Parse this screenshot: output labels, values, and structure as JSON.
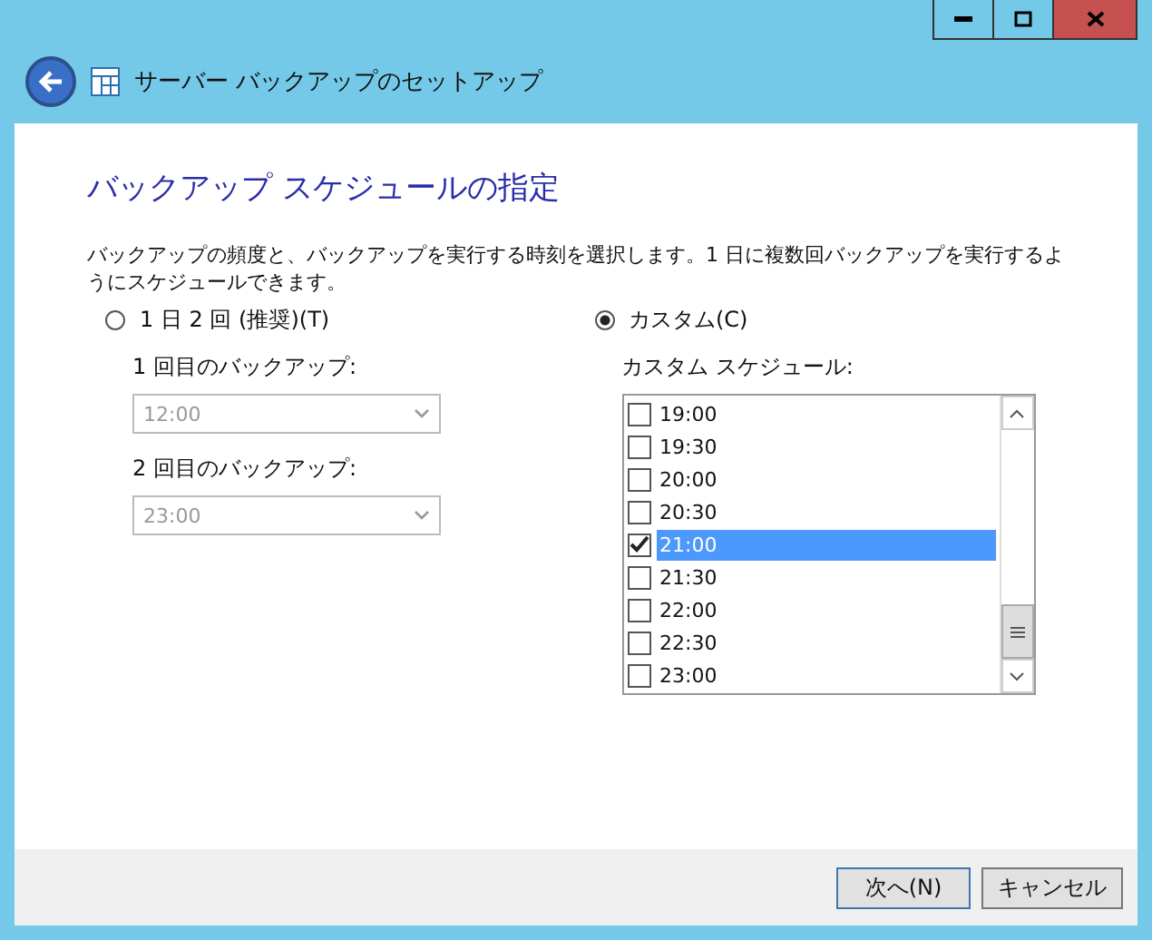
{
  "window": {
    "title": "サーバー バックアップのセットアップ"
  },
  "page": {
    "heading": "バックアップ スケジュールの指定",
    "description": "バックアップの頻度と、バックアップを実行する時刻を選択します。1 日に複数回バックアップを実行するようにスケジュールできます。"
  },
  "options": [
    {
      "label": "1 日 2 回 (推奨)(T)",
      "selected": false,
      "fields": [
        {
          "label": "1 回目のバックアップ:",
          "value": "12:00",
          "disabled": true
        },
        {
          "label": "2 回目のバックアップ:",
          "value": "23:00",
          "disabled": true
        }
      ]
    },
    {
      "label": "カスタム(C)",
      "selected": true,
      "list_label": "カスタム スケジュール:",
      "items": [
        {
          "label": "19:00",
          "checked": false,
          "selected": false
        },
        {
          "label": "19:30",
          "checked": false,
          "selected": false
        },
        {
          "label": "20:00",
          "checked": false,
          "selected": false
        },
        {
          "label": "20:30",
          "checked": false,
          "selected": false
        },
        {
          "label": "21:00",
          "checked": true,
          "selected": true
        },
        {
          "label": "21:30",
          "checked": false,
          "selected": false
        },
        {
          "label": "22:00",
          "checked": false,
          "selected": false
        },
        {
          "label": "22:30",
          "checked": false,
          "selected": false
        },
        {
          "label": "23:00",
          "checked": false,
          "selected": false
        }
      ]
    }
  ],
  "buttons": [
    {
      "label": "次へ(N)",
      "kind": "default"
    },
    {
      "label": "キャンセル",
      "kind": "normal"
    }
  ]
}
